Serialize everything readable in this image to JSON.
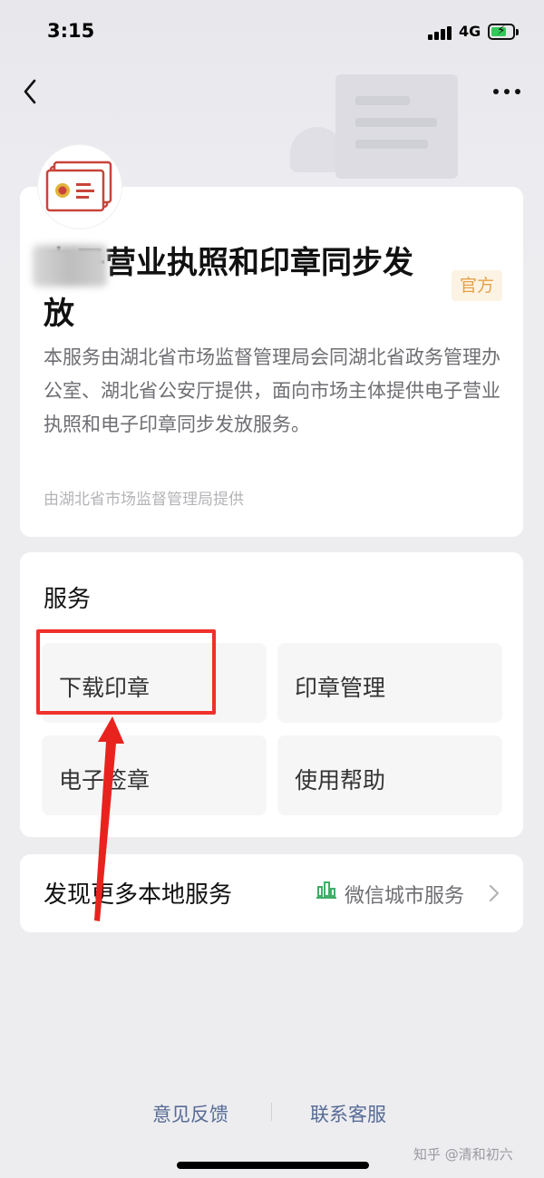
{
  "status_bar": {
    "time": "3:15",
    "network": "4G"
  },
  "service": {
    "title": "电子营业执照和印章同步发放",
    "badge": "官方",
    "description": "本服务由湖北省市场监督管理局会同湖北省政务管理办公室、湖北省公安厅提供，面向市场主体提供电子营业执照和电子印章同步发放服务。",
    "provider": "由湖北省市场监督管理局提供"
  },
  "services_section": {
    "title": "服务",
    "items": [
      {
        "label": "下载印章"
      },
      {
        "label": "印章管理"
      },
      {
        "label": "电子签章"
      },
      {
        "label": "使用帮助"
      }
    ]
  },
  "more_services": {
    "label": "发现更多本地服务",
    "link_label": "微信城市服务"
  },
  "footer": {
    "feedback": "意见反馈",
    "contact": "联系客服"
  },
  "watermark": "知乎 @清和初六",
  "colors": {
    "highlight": "#f0302a",
    "badge_text": "#e4a24a",
    "link": "#576b95",
    "battery": "#34c759"
  },
  "icons": [
    "back-chevron-icon",
    "more-dots-icon",
    "license-logo-icon",
    "city-service-icon",
    "chevron-right-icon",
    "battery-icon",
    "signal-icon"
  ]
}
